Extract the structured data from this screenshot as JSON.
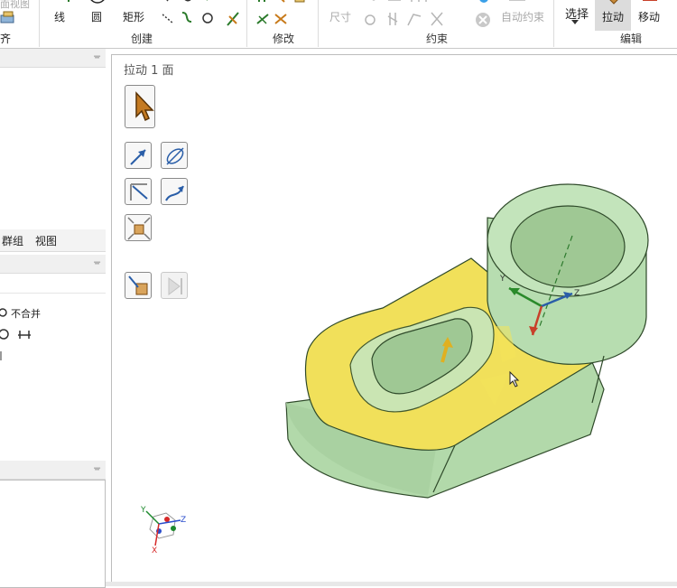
{
  "ribbon": {
    "partial_top_label": "面视图",
    "align_label": "齐",
    "create": {
      "line_label": "线",
      "circle_label": "圆",
      "rect_label": "矩形",
      "group_label": "创建"
    },
    "modify": {
      "group_label": "修改"
    },
    "constrain": {
      "dimension_label": "尺寸",
      "auto_label": "自动约束",
      "group_label": "约束"
    },
    "edit": {
      "select_label": "选择",
      "pull_label": "拉动",
      "move_label": "移动",
      "group_label": "编辑"
    }
  },
  "left_panel": {
    "tabs": [
      "群组",
      "视图"
    ],
    "no_merge_label": "不合并"
  },
  "viewport": {
    "title": "拉动 1 面",
    "triad_labels": {
      "x": "X",
      "y": "Y",
      "z": "Z"
    }
  },
  "colors": {
    "part_fill": "#b7ddb0",
    "part_edge": "#2f4a2a",
    "selected_face": "#f1e05a",
    "accent_active": "#dcdcdc"
  }
}
